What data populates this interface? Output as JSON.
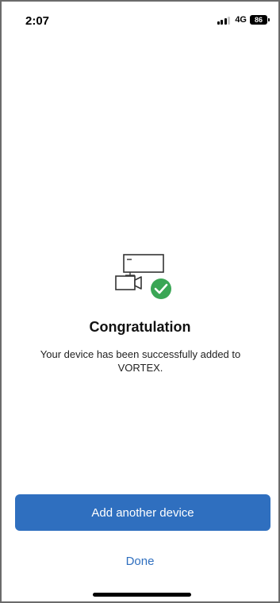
{
  "status_bar": {
    "time": "2:07",
    "network": "4G",
    "battery": "86",
    "signal_icon": "cellular-signal-icon"
  },
  "illustration": {
    "icons": [
      "monitor-icon",
      "camera-icon",
      "check-circle-icon"
    ],
    "check_color": "#3aa655"
  },
  "content": {
    "title": "Congratulation",
    "message": "Your device has been successfully added to VORTEX."
  },
  "actions": {
    "primary_label": "Add another device",
    "secondary_label": "Done",
    "accent_color": "#2f6fbf"
  }
}
